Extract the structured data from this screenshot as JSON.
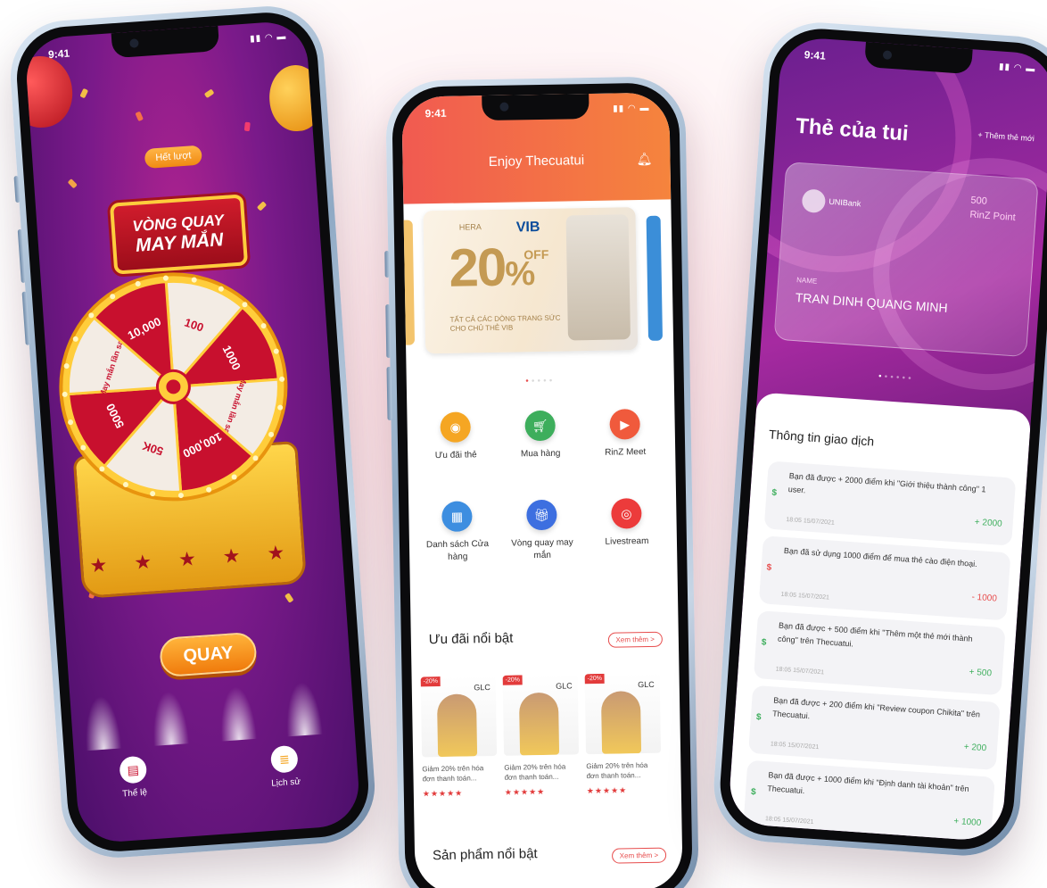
{
  "phone1": {
    "status_time": "9:41",
    "het_luot": "Hết lượt",
    "banner_line1": "VÒNG QUAY",
    "banner_line2": "MAY MẮN",
    "wheel_segments": [
      "100",
      "1000",
      "May mắn lần sau",
      "100,000",
      "50K",
      "5000",
      "May mắn lần sau",
      "10,000"
    ],
    "quay_label": "QUAY",
    "actions": [
      {
        "label": "Thể lệ",
        "icon": "rules-icon"
      },
      {
        "label": "Lịch sử",
        "icon": "history-icon"
      }
    ]
  },
  "phone2": {
    "status_time": "9:41",
    "header_title": "Enjoy Thecuatui",
    "promo": {
      "brand1": "HERA",
      "brand2": "VIB",
      "big": "20",
      "pct": "%",
      "off": "OFF",
      "text": "TẤT CẢ CÁC DÒNG TRANG SỨC CHO CHỦ THẺ VIB"
    },
    "menu": [
      {
        "label": "Ưu đãi thẻ",
        "color": "#f5a623",
        "icon": "card-offer-icon"
      },
      {
        "label": "Mua hàng",
        "color": "#3dae5c",
        "icon": "cart-icon"
      },
      {
        "label": "RinZ Meet",
        "color": "#f05a3c",
        "icon": "video-icon"
      },
      {
        "label": "Danh sách Cửa hàng",
        "color": "#3d8ee0",
        "icon": "store-list-icon"
      },
      {
        "label": "Vòng quay may mắn",
        "color": "#3d6fe0",
        "icon": "gift-icon"
      },
      {
        "label": "Livestream",
        "color": "#ec3b3b",
        "icon": "livestream-icon"
      }
    ],
    "featured_title": "Ưu đãi nổi bật",
    "more_label": "Xem thêm >",
    "products": [
      {
        "badge": "-20%",
        "brand": "GLC",
        "desc": "Giảm 20% trên hóa đơn thanh toán...",
        "stars": "★★★★★"
      },
      {
        "badge": "-20%",
        "brand": "GLC",
        "desc": "Giảm 20% trên hóa đơn thanh toán...",
        "stars": "★★★★★"
      },
      {
        "badge": "-20%",
        "brand": "GLC",
        "desc": "Giảm 20% trên hóa đơn thanh toán...",
        "stars": "★★★★★"
      }
    ],
    "products_title": "Sản phẩm nổi bật",
    "more_label2": "Xem thêm >"
  },
  "phone3": {
    "status_time": "9:41",
    "title": "Thẻ của tui",
    "add_card": "+ Thêm thẻ mới",
    "card": {
      "bank": "UNIBank",
      "points": "500",
      "points_unit": "RinZ Point",
      "name_label": "NAME",
      "name_value": "TRAN DINH QUANG MINH"
    },
    "tx_title": "Thông tin giao dịch",
    "transactions": [
      {
        "text": "Bạn đã được + 2000 điểm khi \"Giới thiệu thành công\" 1 user.",
        "time": "18:05   15/07/2021",
        "amount": "+ 2000",
        "type": "plus"
      },
      {
        "text": "Bạn đã sử dụng 1000 điểm để mua thẻ cào điện thoại.",
        "time": "18:05   15/07/2021",
        "amount": "- 1000",
        "type": "minus"
      },
      {
        "text": "Bạn đã được + 500 điểm khi \"Thêm một thẻ mới thành công\" trên Thecuatui.",
        "time": "18:05   15/07/2021",
        "amount": "+ 500",
        "type": "plus"
      },
      {
        "text": "Bạn đã được + 200 điểm khi \"Review coupon Chikita\" trên Thecuatui.",
        "time": "18:05   15/07/2021",
        "amount": "+ 200",
        "type": "plus"
      },
      {
        "text": "Bạn đã được + 1000 điểm khi \"Định danh tài khoản\" trên Thecuatui.",
        "time": "18:05   15/07/2021",
        "amount": "+ 1000",
        "type": "plus"
      }
    ]
  },
  "colors": {
    "accent": "#f15a51",
    "plus": "#3dae5c",
    "minus": "#e74c4c",
    "wheel_red": "#c8102e",
    "wheel_gold": "#ffcd3b"
  }
}
